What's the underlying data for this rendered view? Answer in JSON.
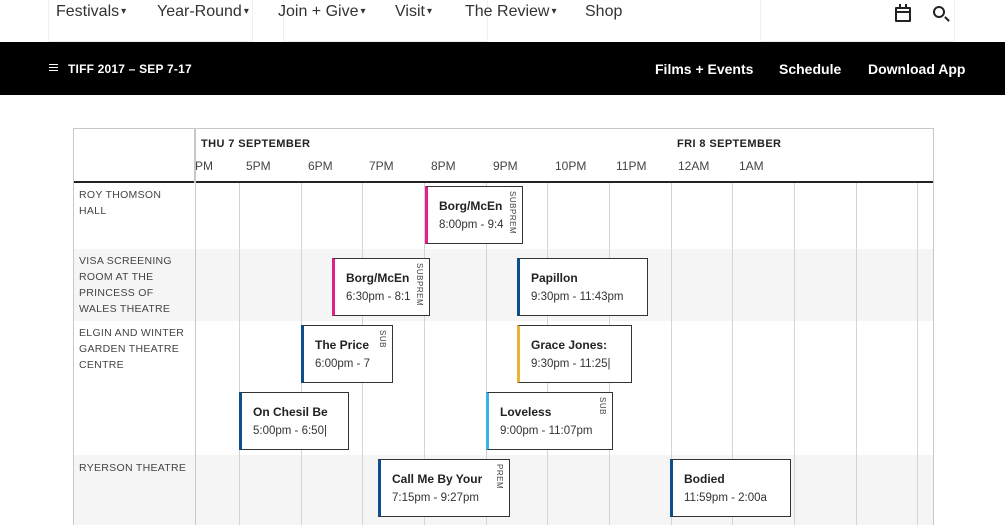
{
  "top_nav": {
    "items": [
      {
        "label": "Festivals"
      },
      {
        "label": "Year-Round"
      },
      {
        "label": "Join + Give"
      },
      {
        "label": "Visit"
      },
      {
        "label": "The Review"
      }
    ],
    "shop_label": "Shop",
    "calendar_icon": "calendar-icon",
    "search_icon": "search-icon"
  },
  "festival_bar": {
    "title": "TIFF 2017 – SEP 7-17",
    "links": [
      "Films + Events",
      "Schedule",
      "Download App"
    ]
  },
  "schedule": {
    "days": [
      "THU 7 SEPTEMBER",
      "FRI 8 SEPTEMBER"
    ],
    "hours": [
      "PM",
      "5PM",
      "6PM",
      "7PM",
      "8PM",
      "9PM",
      "10PM",
      "11PM",
      "12AM",
      "1AM"
    ],
    "venues": [
      {
        "name": "ROY THOMSON HALL"
      },
      {
        "name": "VISA SCREENING ROOM AT THE PRINCESS OF WALES THEATRE"
      },
      {
        "name": "ELGIN AND WINTER GARDEN THEATRE CENTRE"
      },
      {
        "name": "RYERSON THEATRE"
      }
    ],
    "events": [
      {
        "title": "Borg/McEn",
        "time": "8:00pm - 9:4",
        "tags": [
          "SUB",
          "PREM"
        ],
        "color": "#e0218a"
      },
      {
        "title": "Borg/McEn",
        "time": "6:30pm - 8:1",
        "tags": [
          "SUB",
          "PREM"
        ],
        "color": "#e0218a"
      },
      {
        "title": "Papillon",
        "time": "9:30pm - 11:43pm",
        "tags": [],
        "color": "#0d4f8b"
      },
      {
        "title": "The Price",
        "time": "6:00pm - 7",
        "tags": [
          "SUB"
        ],
        "color": "#0d4f8b"
      },
      {
        "title": "Grace Jones:",
        "time": "9:30pm - 11:25|",
        "tags": [],
        "color": "#e8b43a"
      },
      {
        "title": "On Chesil Be",
        "time": "5:00pm - 6:50|",
        "tags": [],
        "color": "#0d4f8b"
      },
      {
        "title": "Loveless",
        "time": "9:00pm - 11:07pm",
        "tags": [
          "SUB"
        ],
        "color": "#3bb2e6"
      },
      {
        "title": "Call Me By Your",
        "time": "7:15pm - 9:27pm",
        "tags": [
          "PREM"
        ],
        "color": "#0d4f8b"
      },
      {
        "title": "Bodied",
        "time": "11:59pm - 2:00a",
        "tags": [],
        "color": "#0d4f8b"
      }
    ]
  }
}
